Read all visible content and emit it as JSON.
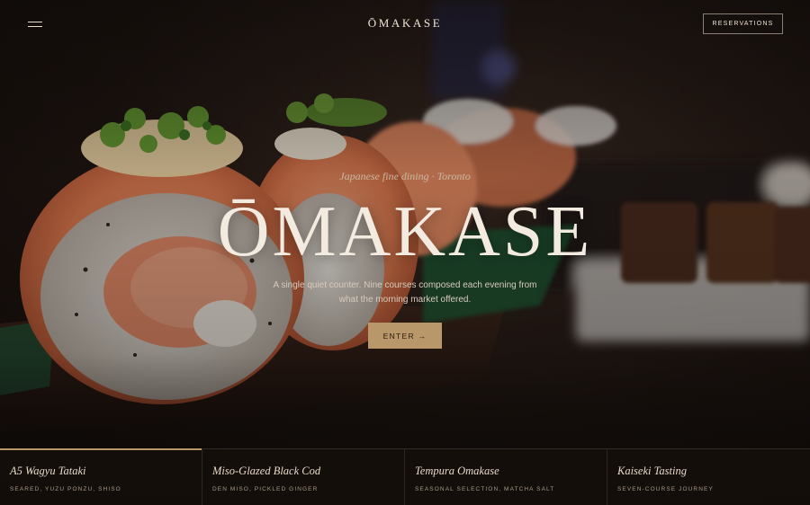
{
  "header": {
    "brand": "ŌMAKASE",
    "reservations_label": "RESERVATIONS"
  },
  "hero": {
    "eyebrow": "Japanese fine dining · Toronto",
    "title": "ŌMAKASE",
    "tagline": "A single quiet counter. Nine courses composed each evening from what the morning market offered.",
    "enter_label": "ENTER →"
  },
  "dishes": [
    {
      "name": "A5 Wagyu Tataki",
      "desc": "SEARED, YUZU PONZU, SHISO",
      "active": true
    },
    {
      "name": "Miso-Glazed Black Cod",
      "desc": "DEN MISO, PICKLED GINGER",
      "active": false
    },
    {
      "name": "Tempura Omakase",
      "desc": "SEASONAL SELECTION, MATCHA SALT",
      "active": false
    },
    {
      "name": "Kaiseki Tasting",
      "desc": "SEVEN-COURSE JOURNEY",
      "active": false
    }
  ],
  "colors": {
    "accent": "#b8976a",
    "background": "#140e0b",
    "text": "#efe6da"
  },
  "icons": {
    "menu": "hamburger-menu-icon",
    "enter_arrow": "arrow-right-icon"
  }
}
